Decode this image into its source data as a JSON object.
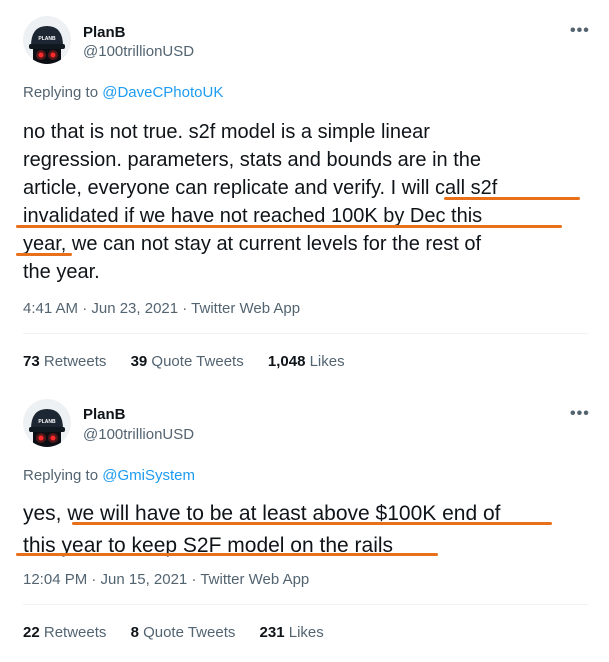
{
  "tweets": [
    {
      "name": "PlanB",
      "handle": "@100trillionUSD",
      "more": "•••",
      "replying_prefix": "Replying to ",
      "replying_to": "@DaveCPhotoUK",
      "body_lines": [
        "no that is not true. s2f model is a simple linear",
        "regression. parameters, stats and bounds are in the",
        "article, everyone can replicate and verify. I will call s2f",
        "invalidated if we have not reached 100K by Dec this",
        "year, we can not stay at current levels for the rest of",
        "the year."
      ],
      "timestamp": "4:41 AM · Jun 23, 2021 · Twitter Web App",
      "retweets": "73",
      "retweets_label": "Retweets",
      "quotes": "39",
      "quotes_label": "Quote Tweets",
      "likes": "1,048",
      "likes_label": "Likes"
    },
    {
      "name": "PlanB",
      "handle": "@100trillionUSD",
      "more": "•••",
      "replying_prefix": "Replying to ",
      "replying_to": "@GmiSystem",
      "body_lines": [
        "yes, we will have to be at least above $100K end of",
        "this year to keep S2F model on the rails"
      ],
      "timestamp": "12:04 PM · Jun 15, 2021 · Twitter Web App",
      "retweets": "22",
      "retweets_label": "Retweets",
      "quotes": "8",
      "quotes_label": "Quote Tweets",
      "likes": "231",
      "likes_label": "Likes"
    }
  ],
  "avatar_text": "PLANB",
  "colors": {
    "underline": "#e8701a",
    "mention": "#1d9bf0",
    "secondary": "#536471",
    "avatar_bg": "#1c2733",
    "avatar_eyes": "#ff2a2a"
  }
}
